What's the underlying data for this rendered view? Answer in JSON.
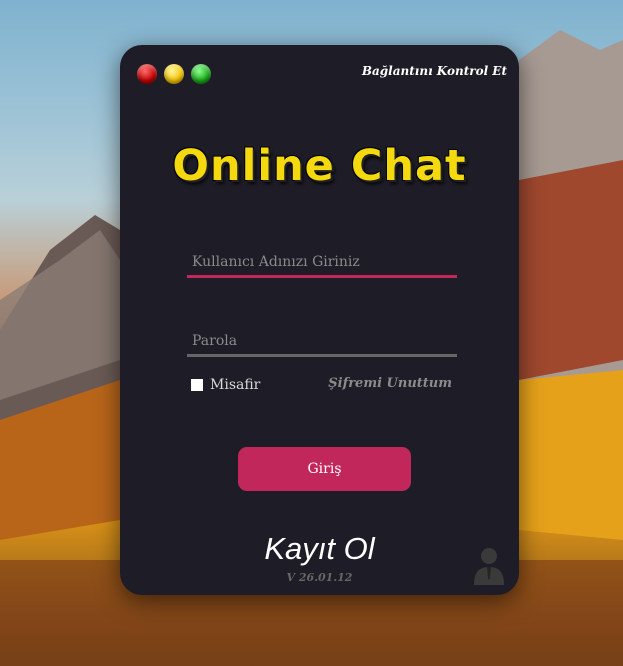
{
  "window": {
    "connection_check": "Bağlantını Kontrol Et",
    "controls": [
      "close-button",
      "minimize-button",
      "maximize-button"
    ]
  },
  "brand": {
    "title": "Online Chat",
    "color": "#f5d90f"
  },
  "form": {
    "username_placeholder": "Kullanıcı Adınızı Giriniz",
    "password_placeholder": "Parola",
    "guest_label": "Misafir",
    "forgot_password": "Şifremi Unuttum",
    "login_button": "Giriş"
  },
  "footer": {
    "register": "Kayıt Ol",
    "version": "V 26.01.12"
  },
  "colors": {
    "accent": "#c2275c",
    "window_bg": "#1e1d27"
  },
  "icons": [
    "user-silhouette-icon"
  ]
}
